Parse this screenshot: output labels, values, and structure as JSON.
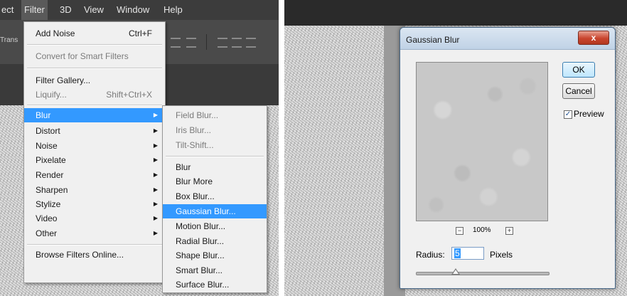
{
  "menubar": {
    "items": [
      "ect",
      "Filter",
      "3D",
      "View",
      "Window",
      "Help"
    ],
    "active": "Filter"
  },
  "toolbar": {
    "truncated_label": "Trans"
  },
  "filter_menu": {
    "items": [
      {
        "label": "Add Noise",
        "shortcut": "Ctrl+F",
        "enabled": true
      },
      {
        "label": "Convert for Smart Filters",
        "enabled": false
      },
      {
        "label": "Filter Gallery...",
        "enabled": true
      },
      {
        "label": "Liquify...",
        "shortcut": "Shift+Ctrl+X",
        "enabled": false
      },
      {
        "label": "Blur",
        "submenu": true,
        "highlighted": true
      },
      {
        "label": "Distort",
        "submenu": true
      },
      {
        "label": "Noise",
        "submenu": true
      },
      {
        "label": "Pixelate",
        "submenu": true
      },
      {
        "label": "Render",
        "submenu": true
      },
      {
        "label": "Sharpen",
        "submenu": true
      },
      {
        "label": "Stylize",
        "submenu": true
      },
      {
        "label": "Video",
        "submenu": true
      },
      {
        "label": "Other",
        "submenu": true
      },
      {
        "label": "Browse Filters Online..."
      }
    ]
  },
  "blur_submenu": {
    "items": [
      {
        "label": "Field Blur...",
        "enabled": false
      },
      {
        "label": "Iris Blur...",
        "enabled": false
      },
      {
        "label": "Tilt-Shift...",
        "enabled": false
      },
      {
        "label": "Blur"
      },
      {
        "label": "Blur More"
      },
      {
        "label": "Box Blur..."
      },
      {
        "label": "Gaussian Blur...",
        "highlighted": true
      },
      {
        "label": "Motion Blur..."
      },
      {
        "label": "Radial Blur..."
      },
      {
        "label": "Shape Blur..."
      },
      {
        "label": "Smart Blur..."
      },
      {
        "label": "Surface Blur..."
      }
    ]
  },
  "dialog": {
    "title": "Gaussian Blur",
    "close_glyph": "x",
    "ok_label": "OK",
    "cancel_label": "Cancel",
    "preview_label": "Preview",
    "preview_checked": true,
    "check_glyph": "✓",
    "zoom_out_glyph": "−",
    "zoom_in_glyph": "+",
    "zoom_level": "100%",
    "radius_label": "Radius:",
    "radius_value": "5",
    "unit_label": "Pixels",
    "radius_slider_fraction": 0.3
  },
  "colors": {
    "highlight": "#3399ff",
    "menubar_bg": "#3c3c3c",
    "menu_bg": "#f0f0f0",
    "close_button": "#c9452e"
  }
}
